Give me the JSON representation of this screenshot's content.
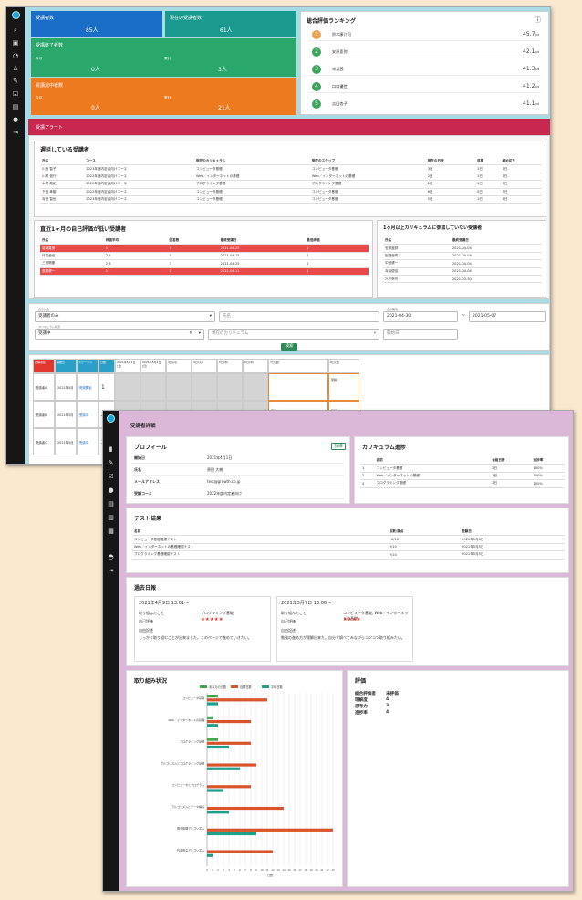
{
  "dashboard": {
    "stat_cards": [
      {
        "title": "受講者数",
        "value": "85人",
        "color": "#1a6ec8"
      },
      {
        "title": "現在の受講者数",
        "value": "61人",
        "color": "#1a9a8e"
      },
      {
        "title": "受講終了者数",
        "sub1_label": "今月",
        "sub1_value": "0人",
        "sub2_label": "累計",
        "sub2_value": "3人",
        "color": "#2aa86c"
      },
      {
        "title": "受講途中者数",
        "sub1_label": "今月",
        "sub1_value": "0人",
        "sub2_label": "累計",
        "sub2_value": "21人",
        "color": "#ee7a1f"
      }
    ],
    "ranking": {
      "title": "総合評価ランキング",
      "items": [
        {
          "rank": "1",
          "name": "鈴木康介司",
          "score": "45.7",
          "unit": "pt",
          "color": "#f0a04b"
        },
        {
          "rank": "2",
          "name": "安原亜弥",
          "score": "42.1",
          "unit": "pt",
          "color": "#3aa65c"
        },
        {
          "rank": "3",
          "name": "米沢茜",
          "score": "41.3",
          "unit": "pt",
          "color": "#3aa65c"
        },
        {
          "rank": "4",
          "name": "口口優世",
          "score": "41.2",
          "unit": "pt",
          "color": "#3aa65c"
        },
        {
          "rank": "5",
          "name": "吉田杏子",
          "score": "41.1",
          "unit": "pt",
          "color": "#3aa65c"
        }
      ]
    },
    "alert_banner": "受講アラート",
    "delayed": {
      "title": "遅延している受講者",
      "headers": [
        "氏名",
        "コース",
        "現在のカリキュラム",
        "現在のステップ",
        "現在の日数",
        "目標",
        "締め切り"
      ],
      "rows": [
        [
          "川島 智子",
          "2023年度内定者向けコース",
          "コンピュータ基礎",
          "コンピュータ基礎",
          "3日",
          "1日",
          "1日"
        ],
        [
          "川村 信行",
          "2022年度内定者向けコース",
          "Web／インターネットの基礎",
          "Web／インターネットの基礎",
          "2日",
          "1日",
          "1日"
        ],
        [
          "木村 政紀",
          "2022年度内定者向けコース",
          "プログラミング基礎",
          "プログラミング基礎",
          "2日",
          "1日",
          "1日"
        ],
        [
          "下田 孝樹",
          "2022年度内定者向けコース",
          "コンピュータ基礎",
          "コンピュータ基礎",
          "6日",
          "5日",
          "5日"
        ],
        [
          "寺田 智也",
          "2023年度内定者向けコース",
          "コンピュータ基礎",
          "コンピュータ基礎",
          "5日",
          "1日",
          "1日"
        ]
      ]
    },
    "low_eval": {
      "title": "直近1ヶ月の自己評価が低い受講者",
      "headers": [
        "氏名",
        "評価平均",
        "回答数",
        "最終受講日",
        "最低評価"
      ],
      "rows": [
        [
          "葛城直美",
          "1",
          "1",
          "2021-04-25",
          "1"
        ],
        [
          "坪井亜也",
          "2.5",
          "3",
          "2021-04-15",
          "5"
        ],
        [
          "三田剛樹",
          "2.3",
          "3",
          "2021-04-25",
          "2"
        ],
        [
          "斎藤健一",
          "1",
          "1",
          "2021-04-11",
          "1"
        ]
      ],
      "highlighted_rows": [
        0,
        3
      ]
    },
    "inactive": {
      "title": "1ヶ月以上カリキュラムに参加していない受講者",
      "headers": [
        "氏名",
        "最終受講日"
      ],
      "rows": [
        [
          "安原亜弥",
          "2021-04-04"
        ],
        [
          "田淵亜希",
          "2021-04-04"
        ],
        [
          "中田健一",
          "2021-04-04"
        ],
        [
          "寺内優佳",
          "2021-04-04"
        ],
        [
          "久米露佳",
          "2021-03-30"
        ]
      ]
    },
    "filters": {
      "status_label": "表示対象",
      "status_value": "受講者のみ",
      "name_placeholder": "氏名",
      "period_label": "表示期間",
      "date_from": "2021-04-30",
      "date_sep": "~",
      "date_to": "2021-05-07",
      "course_label": "カリキュラム状況",
      "course_value": "受講中",
      "curriculum_placeholder": "現在のカリキュラム",
      "start_date_placeholder": "開始日",
      "search_button": "検索"
    },
    "calendar": {
      "headers": [
        "受講者名",
        "開始日",
        "ステータス",
        "日数",
        "2021年5月1日(土)",
        "2021年5月2日(日)",
        "3日(月)",
        "4日(火)",
        "5日(水)",
        "6日(木)",
        "7日(金)",
        "8日(土)"
      ],
      "rows": [
        {
          "name": "受講者A",
          "date": "2021年5月3日",
          "status": "受講開始",
          "days": "1"
        },
        {
          "name": "受講者B",
          "date": "2021年5月3日",
          "status": "受講中",
          "days": "2"
        },
        {
          "name": "受講者C",
          "date": "2021年5月3日",
          "status": "受講中",
          "days": "3"
        }
      ],
      "cell_note": "受講",
      "cell_eval_label": "学習の評価",
      "stars": "★★★"
    }
  },
  "detail": {
    "page_title": "受講者詳細",
    "profile": {
      "title": "プロフィール",
      "edit_button": "詳細",
      "fields": [
        {
          "label": "開始日",
          "value": "2021年4月1日"
        },
        {
          "label": "氏名",
          "value": "原田 大樹"
        },
        {
          "label": "メールアドレス",
          "value": "test@growth.co.jp"
        },
        {
          "label": "受講コース",
          "value": "2022年度内定者向け"
        }
      ]
    },
    "curriculum_progress": {
      "title": "カリキュラム進捗",
      "headers": [
        "",
        "名前",
        "合格日数",
        "進捗率"
      ],
      "rows": [
        [
          "1",
          "コンピュータ基礎",
          "2日",
          "100%"
        ],
        [
          "2",
          "Web／インターネットの基礎",
          "1日",
          "100%"
        ],
        [
          "3",
          "プログラミング基礎",
          "2日",
          "100%"
        ]
      ]
    },
    "tests": {
      "title": "テスト結果",
      "headers": [
        "名前",
        "点数/満点",
        "受験日"
      ],
      "rows": [
        [
          "コンピュータ基礎確認テスト",
          "10/10",
          "2021年5月6日"
        ],
        [
          "Web／インターネットの基礎確認テスト",
          "9/10",
          "2021年5月5日"
        ],
        [
          "プログラミング基礎確認テスト",
          "9/10",
          "2021年5月5日"
        ]
      ]
    },
    "diary": {
      "title": "過去日報",
      "entries": [
        {
          "datetime": "2021年4月9日 13:01〜",
          "topic_label": "取り組んだこと",
          "topic": "プログラミング基礎",
          "eval_label": "自己評価",
          "stars": "★★★★★",
          "note_label": "自由記述",
          "note": "しっかり取り組むことが出来ました。このページで進めていきたい。"
        },
        {
          "datetime": "2021年5月7日 13:00〜",
          "topic_label": "取り組んだこと",
          "topic": "コンピュータ基礎, Web／インターネットの基礎",
          "eval_label": "自己評価",
          "stars": "★★★★",
          "note_label": "自由記述",
          "note": "勉強の進め方が理解出来た。自分で調べてみながらコツコツ取り組みたい。"
        }
      ]
    },
    "effort": {
      "title": "取り組み状況",
      "legend": [
        "あなたの日数",
        "目標日数",
        "平均日数"
      ],
      "legend_colors": [
        "#3fa84a",
        "#d9532b",
        "#1f9e8c"
      ]
    },
    "evaluation": {
      "title": "評価",
      "rows": [
        {
          "label": "総合評価者",
          "value": "末評価"
        },
        {
          "label": "理解度",
          "value": "4"
        },
        {
          "label": "思考力",
          "value": "3"
        },
        {
          "label": "進捗率",
          "value": "4"
        }
      ]
    }
  },
  "chart_data": {
    "type": "bar",
    "orientation": "horizontal",
    "categories": [
      "コンピュータ基礎",
      "Web／インターネットの基礎",
      "プログラミング基礎",
      "アルゴリズムとプログラミング基礎",
      "コンピュータとプログラム",
      "アルゴリズムとデータ構造",
      "数式処理アルゴリズム",
      "代表的なアルゴリズム"
    ],
    "series": [
      {
        "name": "あなたの日数",
        "values": [
          2,
          1,
          2,
          0,
          0,
          0,
          0,
          0
        ]
      },
      {
        "name": "目標日数",
        "values": [
          11,
          8,
          8,
          9,
          8,
          14,
          23,
          12
        ]
      },
      {
        "name": "平均日数",
        "values": [
          2,
          2,
          4,
          6,
          3,
          4,
          9,
          1
        ]
      }
    ],
    "xlim": [
      0,
      23
    ],
    "xticks": [
      "0",
      "1",
      "2",
      "3",
      "4",
      "5",
      "6",
      "7",
      "8",
      "9",
      "10",
      "11",
      "12",
      "13",
      "14",
      "15",
      "16",
      "17",
      "18",
      "19",
      "20",
      "21",
      "22",
      "23"
    ],
    "xlabel": "日数",
    "grid": true,
    "legend": "top"
  }
}
